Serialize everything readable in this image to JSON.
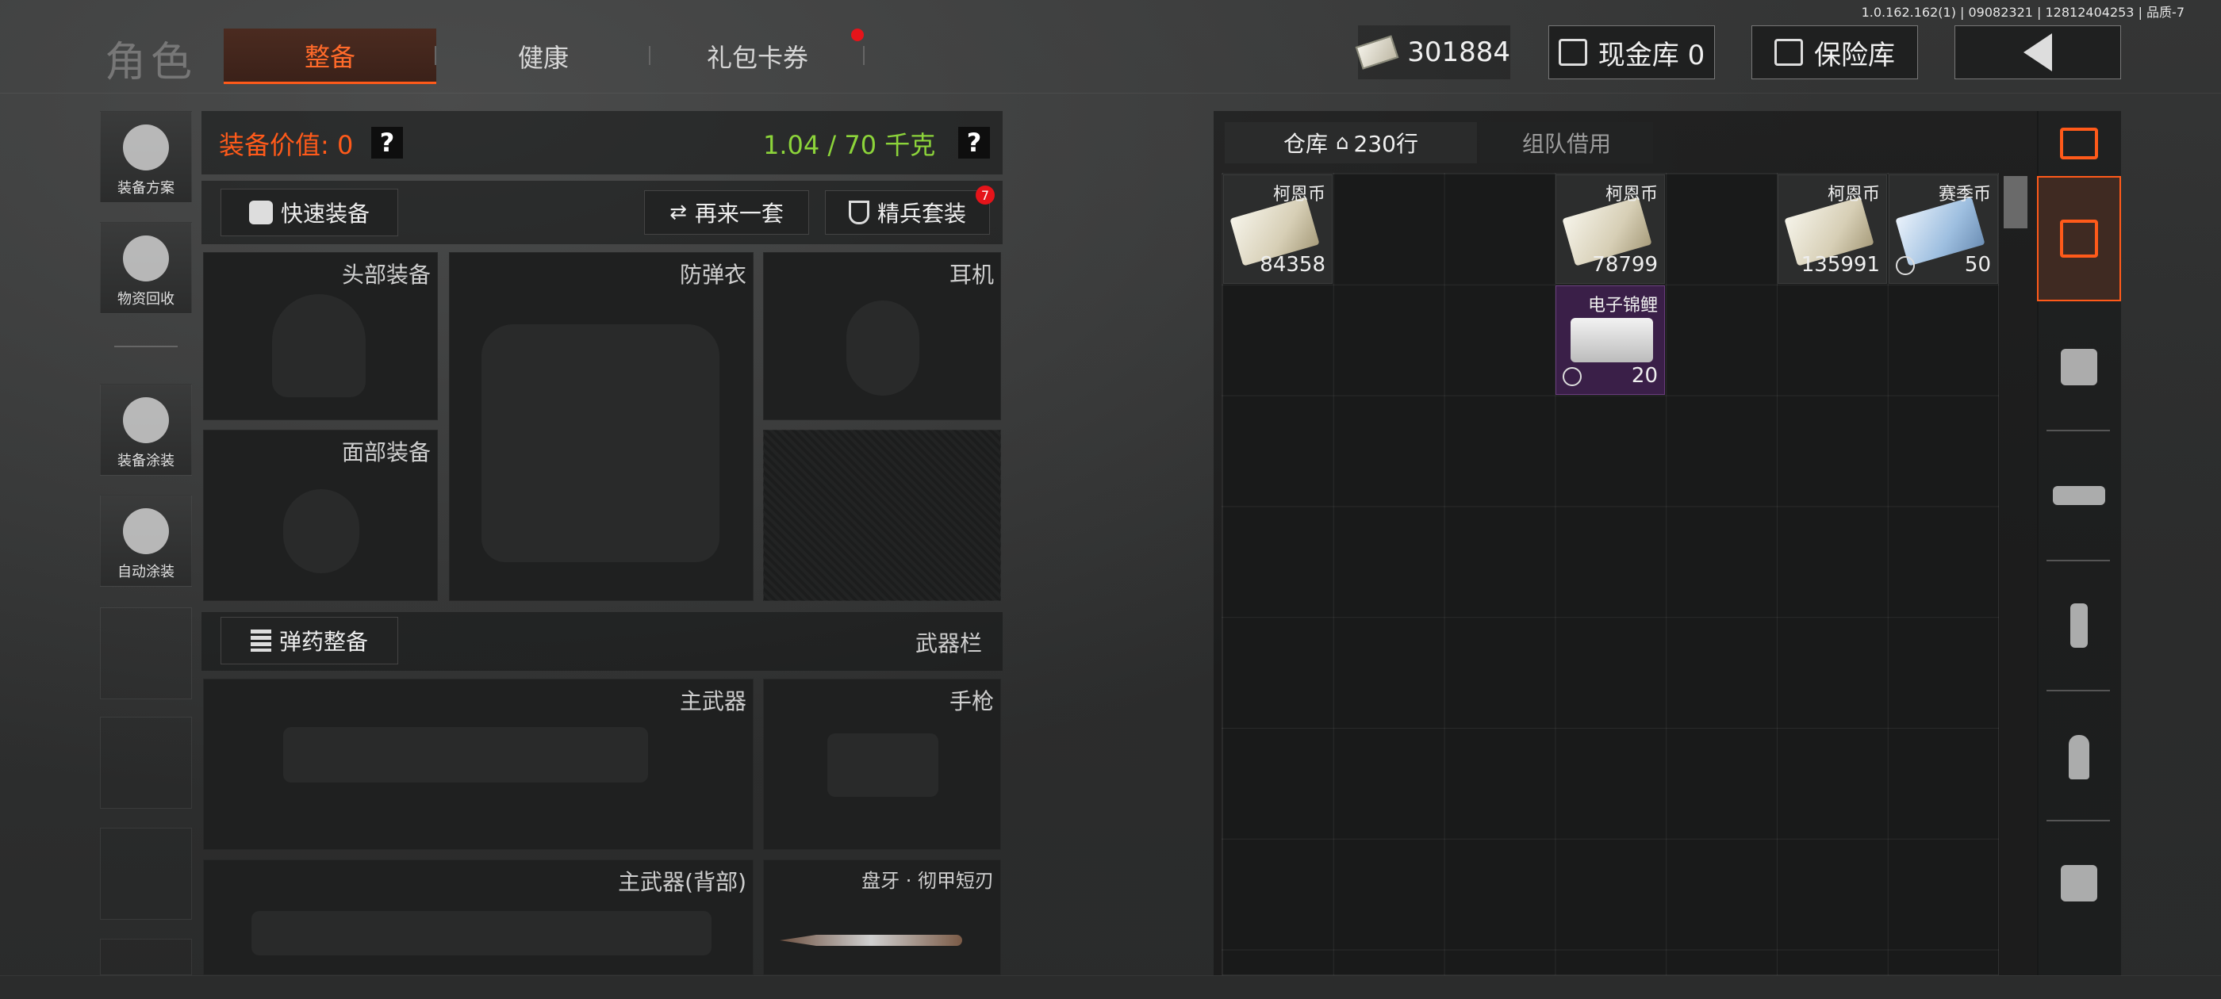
{
  "version": "1.0.162.162(1) | 09082321 | 12812404253 | 品质-7",
  "header": {
    "role_title": "角色",
    "tabs": [
      {
        "label": "整备",
        "active": true
      },
      {
        "label": "健康",
        "active": false
      },
      {
        "label": "礼包卡券",
        "active": false,
        "notification": true
      }
    ],
    "currency_value": "301884",
    "cash_vault_label": "现金库 0",
    "safe_label": "保险库"
  },
  "sidebar": {
    "items": [
      {
        "label": "装备方案"
      },
      {
        "label": "物资回收"
      },
      {
        "label": "装备涂装"
      },
      {
        "label": "自动涂装"
      }
    ]
  },
  "equipment": {
    "value_label": "装备价值: 0",
    "weight_label": "1.04 / 70 千克",
    "help_glyph": "?",
    "quick_equip_label": "快速装备",
    "again_label": "再来一套",
    "elite_label": "精兵套装",
    "elite_badge": "7",
    "slots": {
      "head": "头部装备",
      "armor": "防弹衣",
      "headset": "耳机",
      "face": "面部装备"
    },
    "ammo_button_label": "弹药整备",
    "weapon_bar_label": "武器栏",
    "weapons": {
      "primary": "主武器",
      "pistol": "手枪",
      "primary_back": "主武器(背部)",
      "melee": "盘牙 · 彻甲短刃"
    }
  },
  "stash": {
    "tab_warehouse": "仓库",
    "rows_label": "230行",
    "tab_team": "组队借用",
    "items": [
      {
        "name": "柯恩币",
        "count": "84358",
        "col": 0,
        "row": 0,
        "kind": "cash"
      },
      {
        "name": "柯恩币",
        "count": "78799",
        "col": 3,
        "row": 0,
        "kind": "cash"
      },
      {
        "name": "柯恩币",
        "count": "135991",
        "col": 5,
        "row": 0,
        "kind": "cash"
      },
      {
        "name": "赛季币",
        "count": "50",
        "col": 6,
        "row": 0,
        "kind": "season"
      },
      {
        "name": "电子锦鲤",
        "count": "20",
        "col": 3,
        "row": 1,
        "kind": "chip"
      }
    ]
  },
  "categories": [
    "all-items",
    "armor",
    "rifle",
    "magazine",
    "ammo",
    "sight"
  ],
  "colors": {
    "accent": "#ff5a1a",
    "weight_ok": "#8cd43a",
    "rare_purple": "#3a1f48"
  }
}
